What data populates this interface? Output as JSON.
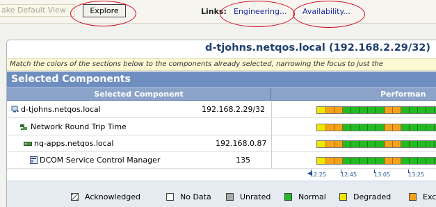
{
  "toolbar": {
    "make_default_label": "ake Default View",
    "explore_label": "Explore",
    "links_label": "Links:",
    "link_engineering": "Engineering...",
    "link_availability": "Availability..."
  },
  "panel": {
    "title": "d-tjohns.netqos.local (192.168.2.29/32)",
    "hint": "Match the colors of the sections below to the components already selected, narrowing the focus to just the",
    "section_title": "Selected Components",
    "col_component": "Selected Component",
    "col_performance": "Performan"
  },
  "rows": [
    {
      "name": "d-tjohns.netqos.local",
      "ip": "192.168.2.29/32",
      "icon": "host-icon"
    },
    {
      "name": "Network Round Trip Time",
      "ip": "",
      "icon": "network-icon"
    },
    {
      "name": "nq-apps.netqos.local",
      "ip": "192.168.0.87",
      "icon": "server-icon"
    },
    {
      "name": "DCOM Service Control Manager",
      "ip": "135",
      "icon": "service-icon"
    }
  ],
  "axis": {
    "labels": [
      "12:25",
      "12:45",
      "13:05",
      "13:25"
    ]
  },
  "legend": {
    "items": [
      {
        "label": "Acknowledged",
        "color": "#ffffff",
        "pattern": "hatch"
      },
      {
        "label": "No Data",
        "color": "#ffffff"
      },
      {
        "label": "Unrated",
        "color": "#a8a8a8"
      },
      {
        "label": "Normal",
        "color": "#22bb22"
      },
      {
        "label": "Degraded",
        "color": "#f2e600"
      },
      {
        "label": "Exc",
        "color": "#f5a21a"
      }
    ]
  },
  "colors": {
    "normal": "#22bb22",
    "degraded": "#f2e600",
    "excessive": "#f5a21a",
    "accent": "#1f3f70",
    "section_bar": "#6f8ec0",
    "annotation_ring": "#d3001b"
  }
}
